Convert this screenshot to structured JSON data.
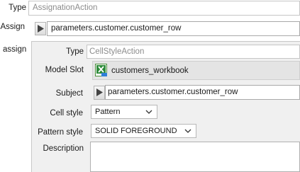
{
  "outer": {
    "type_label": "Type",
    "type_value": "AssignationAction",
    "assign_label": "Assign",
    "assign_value": "parameters.customer.customer_row",
    "assign_section_label": "assign"
  },
  "inner": {
    "type_label": "Type",
    "type_value": "CellStyleAction",
    "model_slot_label": "Model Slot",
    "model_slot_value": "customers_workbook",
    "model_slot_icon": "excel-workbook-icon",
    "subject_label": "Subject",
    "subject_value": "parameters.customer.customer_row",
    "cell_style_label": "Cell style",
    "cell_style_value": "Pattern",
    "pattern_style_label": "Pattern style",
    "pattern_style_value": "SOLID FOREGROUND",
    "description_label": "Description",
    "description_value": ""
  },
  "colors": {
    "panel_bg": "#f0f0f0",
    "excel_green": "#2e8b3a"
  }
}
